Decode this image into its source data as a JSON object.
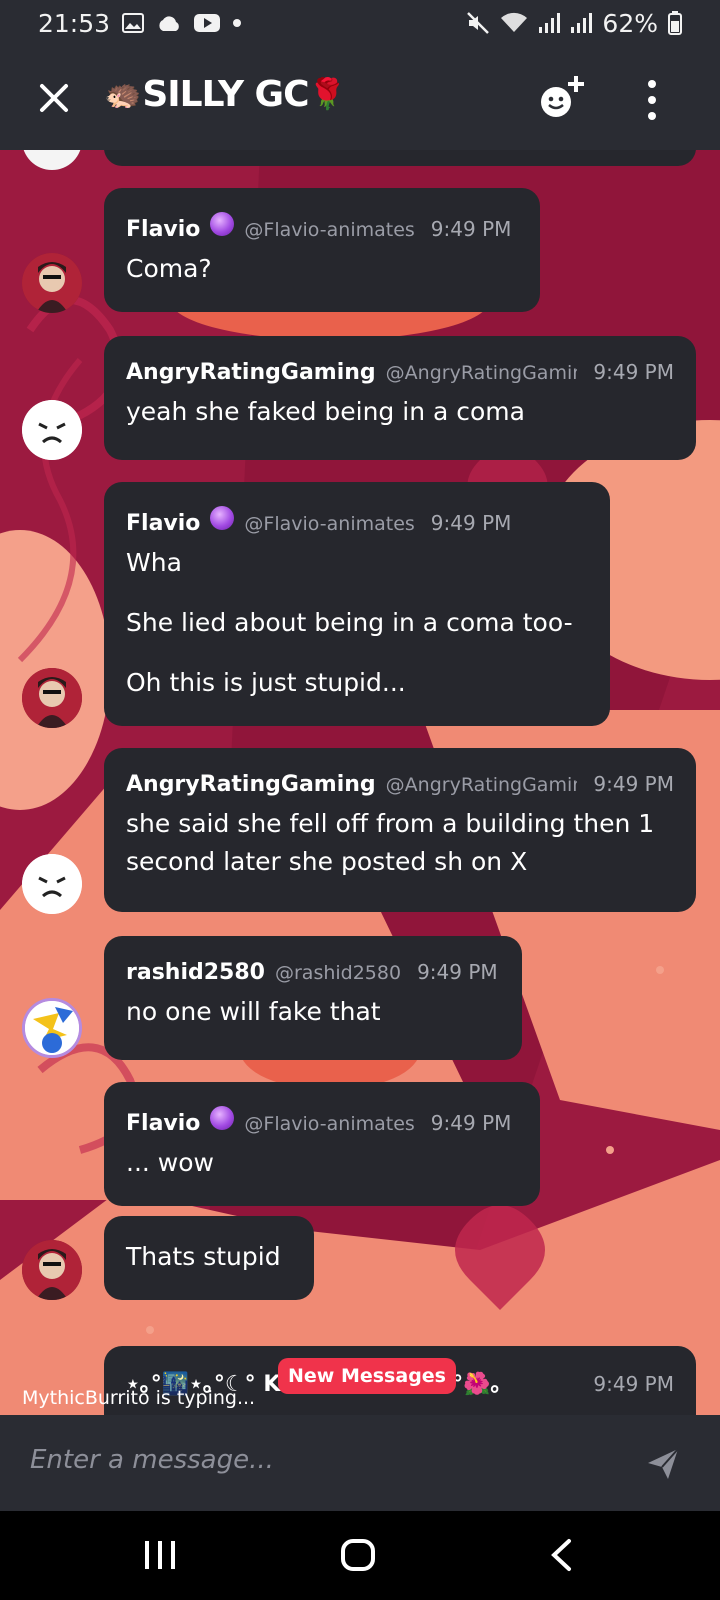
{
  "status_bar": {
    "time": "21:53",
    "battery": "62%",
    "left_icons": [
      "gallery-icon",
      "cloud-icon",
      "youtube-icon",
      "dot-icon"
    ],
    "right_icons": [
      "mute-icon",
      "wifi-icon",
      "signal-icon",
      "signal-icon",
      "battery-icon"
    ]
  },
  "header": {
    "title": "SILLY GC",
    "title_prefix_emoji": "🦔",
    "title_suffix_emoji": "🌹",
    "close_icon": "close-icon",
    "add_member_icon": "add-member-icon",
    "more_icon": "more-vertical-icon"
  },
  "messages": [
    {
      "name": "Flavio",
      "handle": "@Flavio-animates",
      "time": "9:49 PM",
      "badge": "crystal-ball",
      "lines": [
        "Coma?"
      ]
    },
    {
      "name": "AngryRatingGaming",
      "handle": "@AngryRatingGamin",
      "time": "9:49 PM",
      "lines": [
        "yeah she faked being in a coma"
      ]
    },
    {
      "name": "Flavio",
      "handle": "@Flavio-animates",
      "time": "9:49 PM",
      "badge": "crystal-ball",
      "lines": [
        "Wha",
        "She lied about being in a coma too-",
        "Oh this is just stupid..."
      ]
    },
    {
      "name": "AngryRatingGaming",
      "handle": "@AngryRatingGamin",
      "time": "9:49 PM",
      "lines": [
        "she said she fell off from a building then 1",
        "second later she posted sh on X"
      ]
    },
    {
      "name": "rashid2580",
      "handle": "@rashid2580",
      "time": "9:49 PM",
      "lines": [
        "no one will fake that"
      ]
    },
    {
      "name": "Flavio",
      "handle": "@Flavio-animates",
      "time": "9:49 PM",
      "badge": "crystal-ball",
      "lines": [
        "... wow"
      ]
    },
    {
      "lines": [
        "Thats stupid"
      ]
    },
    {
      "name": "⋆｡°🌃⋆｡°☾° K i t s u n e Z⋆｡°🌺｡",
      "time": "9:49 PM"
    }
  ],
  "new_messages_label": "New Messages",
  "typing_indicator": "MythicBurrito is typing...",
  "composer": {
    "placeholder": "Enter a message...",
    "send_icon": "send-icon"
  },
  "nav_bar": {
    "buttons": [
      "recents-icon",
      "home-icon",
      "back-icon"
    ]
  },
  "colors": {
    "message_bg": "#26272d",
    "bar_bg": "#2a2c33",
    "wallpaper_dark": "#9c1a40",
    "wallpaper_light": "#f08a74",
    "new_messages_badge": "#f0334b"
  }
}
